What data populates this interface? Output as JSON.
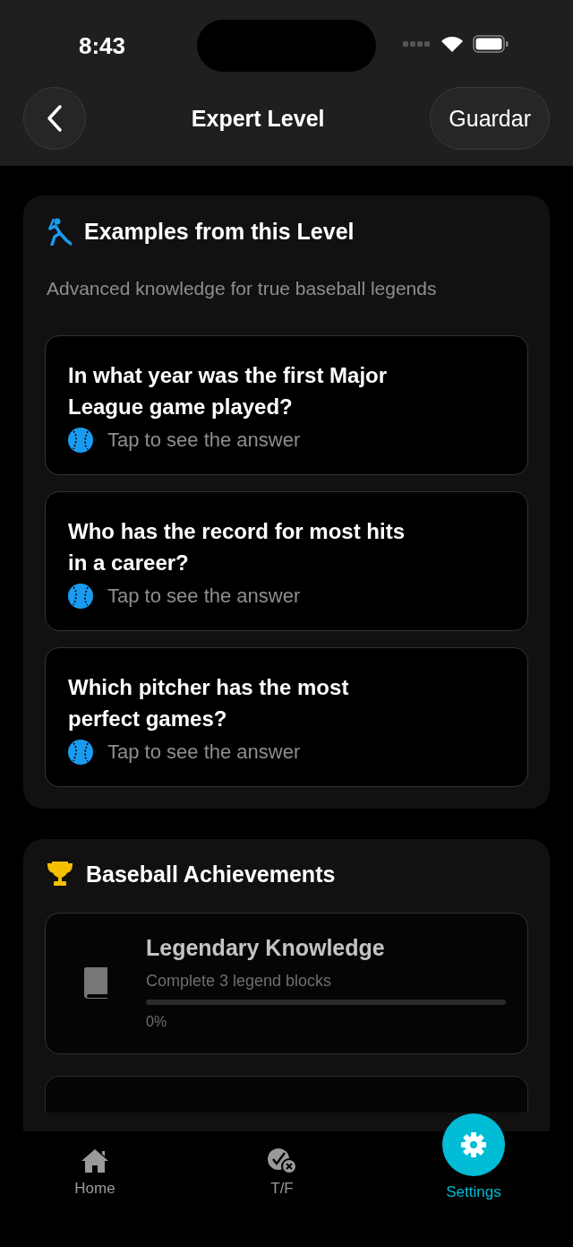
{
  "status_bar": {
    "time": "8:43"
  },
  "nav": {
    "title": "Expert Level",
    "action": "Guardar"
  },
  "examples": {
    "title": "Examples from this Level",
    "subtitle": "Advanced knowledge for true baseball legends",
    "questions": [
      {
        "question": "In what year was the first Major League game played?",
        "hint": "Tap to see the answer"
      },
      {
        "question": "Who has the record for most hits in a career?",
        "hint": "Tap to see the answer"
      },
      {
        "question": "Which pitcher has the most perfect games?",
        "hint": "Tap to see the answer"
      }
    ]
  },
  "achievements": {
    "title": "Baseball Achievements",
    "items": [
      {
        "title": "Legendary Knowledge",
        "description": "Complete 3 legend blocks",
        "level": 0,
        "reading": "0%"
      }
    ]
  },
  "tabs": [
    {
      "label": "Home",
      "kind": "home",
      "selected": false
    },
    {
      "label": "T/F",
      "kind": "truefalse",
      "selected": false
    },
    {
      "label": "Settings",
      "kind": "settings",
      "selected": true
    }
  ]
}
